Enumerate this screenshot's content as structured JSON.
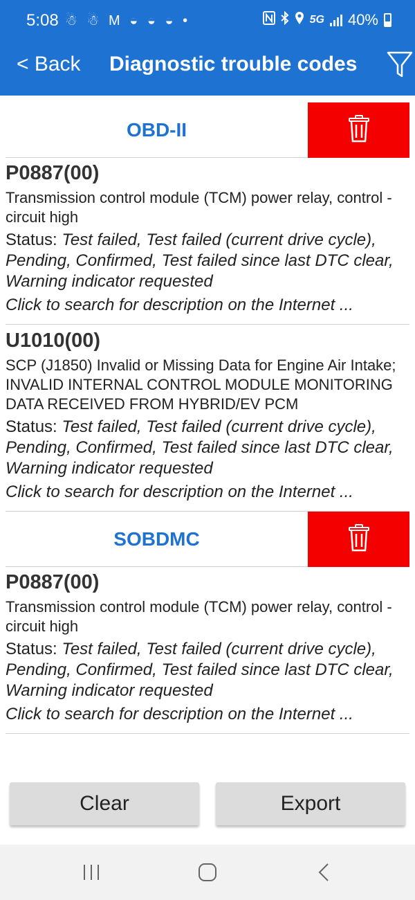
{
  "status_bar": {
    "time": "5:08",
    "notification_icons": "☃ ☃ M ◒ ◒ ◒ •",
    "network": "5G",
    "battery_percent": "40%",
    "battery_level": 0.4,
    "icons": [
      "nfc-icon",
      "bluetooth-icon",
      "location-icon",
      "signal-icon",
      "battery-icon"
    ]
  },
  "header": {
    "back_label": "< Back",
    "title": "Diagnostic trouble codes",
    "filter_icon": "filter-icon"
  },
  "sections": [
    {
      "name": "OBD-II",
      "delete_icon": "trash-icon",
      "codes": [
        {
          "code": "P0887(00)",
          "description": "Transmission control module (TCM) power relay, control - circuit high",
          "status_label": "Status: ",
          "status": "Test failed, Test failed (current drive cycle), Pending, Confirmed, Test failed since last DTC clear, Warning indicator requested",
          "link": "Click to search for description on the Internet ..."
        },
        {
          "code": "U1010(00)",
          "description": "SCP (J1850) Invalid or Missing Data for Engine Air Intake; INVALID INTERNAL CONTROL MODULE MONITORING DATA RECEIVED FROM HYBRID/EV PCM",
          "status_label": "Status: ",
          "status": "Test failed, Test failed (current drive cycle), Pending, Confirmed, Test failed since last DTC clear, Warning indicator requested",
          "link": "Click to search for description on the Internet ..."
        }
      ]
    },
    {
      "name": "SOBDMC",
      "delete_icon": "trash-icon",
      "codes": [
        {
          "code": "P0887(00)",
          "description": "Transmission control module (TCM) power relay, control - circuit high",
          "status_label": "Status: ",
          "status": "Test failed, Test failed (current drive cycle), Pending, Confirmed, Test failed since last DTC clear, Warning indicator requested",
          "link": "Click to search for description on the Internet ..."
        }
      ]
    }
  ],
  "actions": {
    "clear_label": "Clear",
    "export_label": "Export"
  },
  "system_nav": {
    "recents_icon": "recents-icon",
    "home_icon": "home-icon",
    "back_icon": "back-icon"
  },
  "colors": {
    "header_bg": "#1e73d2",
    "section_title": "#1e73d2",
    "delete_bg": "#f40000",
    "button_bg": "#dcdcdc"
  }
}
